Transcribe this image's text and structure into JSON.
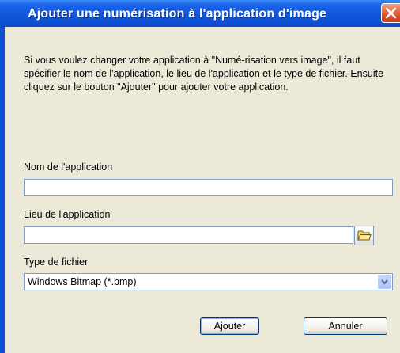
{
  "window": {
    "title": "Ajouter une numérisation à l'application d'image"
  },
  "description": "Si vous voulez changer votre application à \"Numé-risation vers image\", il faut spécifier le nom de l'application, le lieu de l'application et le type de fichier. Ensuite cliquez sur le bouton \"Ajouter\" pour ajouter votre application.",
  "fields": {
    "app_name_label": "Nom de l'application",
    "app_name_value": "",
    "app_location_label": "Lieu de l'application",
    "app_location_value": "",
    "file_type_label": "Type de fichier",
    "file_type_value": "Windows Bitmap (*.bmp)"
  },
  "buttons": {
    "add": "Ajouter",
    "cancel": "Annuler"
  },
  "icons": {
    "close": "close-icon",
    "browse": "folder-icon",
    "dropdown": "chevron-down-icon"
  },
  "colors": {
    "titlebar": "#0f55db",
    "dialog_bg": "#ece9d8",
    "close": "#e0522d"
  }
}
